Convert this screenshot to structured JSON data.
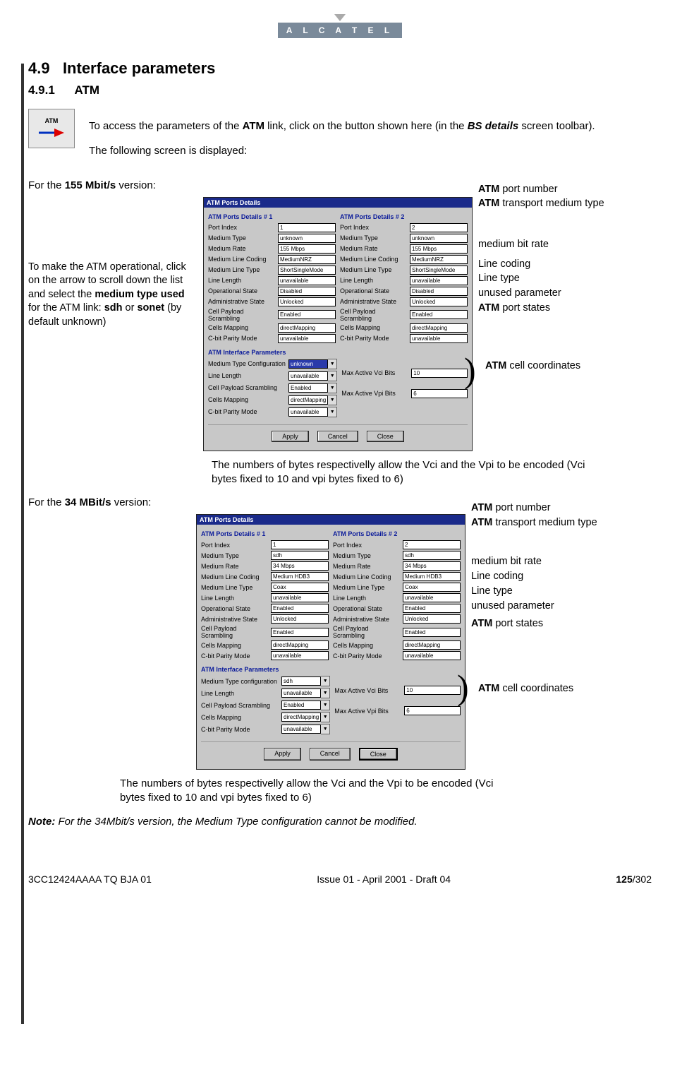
{
  "logo_text": "A L C A T E L",
  "section_number": "4.9",
  "section_title": "Interface parameters",
  "subsection_number": "4.9.1",
  "subsection_title": "ATM",
  "atm_icon_label": "ATM",
  "intro_para_1_a": "To access the parameters of the ",
  "intro_para_1_b": "ATM",
  "intro_para_1_c": " link, click on the button shown here (in the ",
  "intro_para_1_d": "BS details",
  "intro_para_1_e": " screen toolbar).",
  "intro_para_2": "The following screen is displayed:",
  "version_155_a": "For the ",
  "version_155_b": "155 Mbit/s",
  "version_155_c": " version:",
  "left_note_155_a": "To make the ATM operational, click on the arrow to scroll down the list and select the ",
  "left_note_155_b": "medium type used",
  "left_note_155_c": " for the ATM link: ",
  "left_note_155_d": "sdh",
  "left_note_155_e": " or ",
  "left_note_155_f": "sonet",
  "left_note_155_g": " (by default unknown)",
  "dialog155": {
    "title": "ATM Ports Details",
    "group1": "ATM Ports Details # 1",
    "group2": "ATM Ports Details # 2",
    "labels": {
      "port_index": "Port Index",
      "medium_type": "Medium Type",
      "medium_rate": "Medium Rate",
      "line_coding": "Medium Line Coding",
      "line_type": "Medium Line Type",
      "line_length": "Line Length",
      "op_state": "Operational State",
      "admin_state": "Administrative State",
      "scrambling": "Cell Payload Scrambling",
      "mapping": "Cells Mapping",
      "parity": "C-bit Parity Mode"
    },
    "p1": {
      "port_index": "1",
      "medium_type": "unknown",
      "medium_rate": "155 Mbps",
      "line_coding": "MediumNRZ",
      "line_type": "ShortSingleMode",
      "line_length": "unavailable",
      "op_state": "Disabled",
      "admin_state": "Unlocked",
      "scrambling": "Enabled",
      "mapping": "directMapping",
      "parity": "unavailable"
    },
    "p2": {
      "port_index": "2",
      "medium_type": "unknown",
      "medium_rate": "155 Mbps",
      "line_coding": "MediumNRZ",
      "line_type": "ShortSingleMode",
      "line_length": "unavailable",
      "op_state": "Disabled",
      "admin_state": "Unlocked",
      "scrambling": "Enabled",
      "mapping": "directMapping",
      "parity": "unavailable"
    },
    "ifparams_title": "ATM Interface Parameters",
    "iflabels": {
      "medium_type_cfg": "Medium Type Configuration",
      "line_length": "Line Length",
      "scrambling": "Cell Payload Scrambling",
      "mapping": "Cells Mapping",
      "parity": "C-bit Parity Mode",
      "max_vci": "Max Active Vci Bits",
      "max_vpi": "Max Active Vpi Bits"
    },
    "ifvals": {
      "medium_type_cfg": "unknown",
      "line_length": "unavailable",
      "scrambling": "Enabled",
      "mapping": "directMapping",
      "parity": "unavailable",
      "max_vci": "10",
      "max_vpi": "6"
    },
    "buttons": {
      "apply": "Apply",
      "cancel": "Cancel",
      "close": "Close"
    }
  },
  "ann": {
    "port_number_a": "ATM",
    "port_number_b": " port number",
    "transport_a": "ATM",
    "transport_b": " transport medium type",
    "bitrate": "medium bit rate",
    "linecoding": "Line coding",
    "linetype": "Line type",
    "unused": "unused parameter",
    "states_a": "ATM",
    "states_b": " port states",
    "cellcoord_a": "ATM",
    "cellcoord_b": " cell coordinates"
  },
  "caption_vci_vpi": "The numbers of bytes respectivelly allow the Vci and the Vpi to be encoded (Vci bytes fixed to 10 and vpi bytes fixed to 6)",
  "version_34_a": "For the ",
  "version_34_b": "34 MBit/s",
  "version_34_c": " version:",
  "dialog34": {
    "title": "ATM Ports Details",
    "p1": {
      "port_index": "1",
      "medium_type": "sdh",
      "medium_rate": "34 Mbps",
      "line_coding": "Medium HDB3",
      "line_type": "Coax",
      "line_length": "unavailable",
      "op_state": "Enabled",
      "admin_state": "Unlocked",
      "scrambling": "Enabled",
      "mapping": "directMapping",
      "parity": "unavailable"
    },
    "p2": {
      "port_index": "2",
      "medium_type": "sdh",
      "medium_rate": "34 Mbps",
      "line_coding": "Medium HDB3",
      "line_type": "Coax",
      "line_length": "unavailable",
      "op_state": "Enabled",
      "admin_state": "Unlocked",
      "scrambling": "Enabled",
      "mapping": "directMapping",
      "parity": "unavailable"
    },
    "iflabels": {
      "medium_type_cfg": "Medium Type configuration"
    },
    "ifvals": {
      "medium_type_cfg": "sdh",
      "line_length": "unavailable",
      "scrambling": "Enabled",
      "mapping": "directMapping",
      "parity": "unavailable",
      "max_vci": "10",
      "max_vpi": "6"
    }
  },
  "ann34_cellcoord_a": "ATM",
  "ann34_cellcoord_b": " cell coordinates",
  "note_prefix": "Note:",
  "note_text": "  For the 34Mbit/s version, the Medium Type configuration cannot be modified.",
  "footer": {
    "left": "3CC12424AAAA TQ BJA 01",
    "center": "Issue 01 - April 2001 - Draft 04",
    "page_bold": "125",
    "page_total": "/302"
  }
}
